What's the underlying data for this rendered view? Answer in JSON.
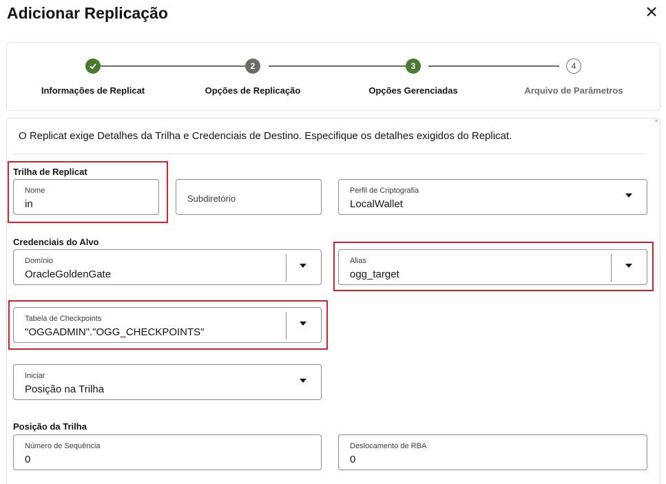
{
  "dialog": {
    "title": "Adicionar Replicação",
    "close_icon": "close-icon"
  },
  "train": {
    "steps": [
      {
        "number": "✓",
        "label": "Informações de Replicat",
        "state": "completed",
        "color": "#4a7a2f"
      },
      {
        "number": "2",
        "label": "Opções de Replicação",
        "state": "visited",
        "color": "#6f6b66"
      },
      {
        "number": "3",
        "label": "Opções Gerenciadas",
        "state": "current",
        "color": "#4a7a2f"
      },
      {
        "number": "4",
        "label": "Arquivo de Parâmetros",
        "state": "disabled",
        "color": "#6f6b66"
      }
    ]
  },
  "intro": "O Replicat exige Detalhes da Trilha e Credenciais de Destino. Especifique os detalhes exigidos do Replicat.",
  "trail": {
    "section_label": "Trilha de Replicat",
    "name": {
      "label": "Nome",
      "value": "in"
    },
    "subdir": {
      "placeholder": "Subdiretório"
    },
    "crypto_profile": {
      "label": "Perfil de Criptografia",
      "value": "LocalWallet"
    }
  },
  "credentials": {
    "section_label": "Credenciais do Alvo",
    "domain": {
      "label": "Domínio",
      "value": "OracleGoldenGate"
    },
    "alias": {
      "label": "Alias",
      "value": "ogg_target"
    },
    "checkpoint_table": {
      "label": "Tabela de Checkpoints",
      "value": "\"OGGADMIN\".\"OGG_CHECKPOINTS\""
    }
  },
  "start": {
    "label": "Iniciar",
    "value": "Posição na Trilha"
  },
  "trail_position": {
    "section_label": "Posição da Trilha",
    "sequence": {
      "label": "Número de Sequência",
      "value": "0"
    },
    "rba_offset": {
      "label": "Deslocamento de RBA",
      "value": "0"
    }
  },
  "colors": {
    "highlight": "#d51f2b",
    "complete": "#4a7a2f",
    "visited": "#6f6b66"
  }
}
